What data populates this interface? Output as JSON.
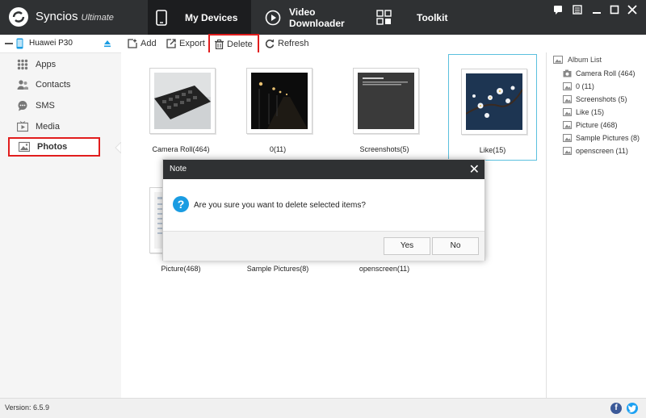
{
  "app": {
    "name": "Syncios",
    "edition": "Ultimate"
  },
  "tabs": [
    {
      "label": "My Devices"
    },
    {
      "label": "Video Downloader"
    },
    {
      "label": "Toolkit"
    }
  ],
  "device": {
    "name": "Huawei P30"
  },
  "sidebar": {
    "items": [
      {
        "label": "Apps"
      },
      {
        "label": "Contacts"
      },
      {
        "label": "SMS"
      },
      {
        "label": "Media"
      },
      {
        "label": "Photos"
      }
    ]
  },
  "toolbar": {
    "add": "Add",
    "export": "Export",
    "delete": "Delete",
    "refresh": "Refresh"
  },
  "albums": [
    {
      "caption": "Camera Roll(464)"
    },
    {
      "caption": "0(11)"
    },
    {
      "caption": "Screenshots(5)"
    },
    {
      "caption": "Like(15)"
    },
    {
      "caption": "Picture(468)"
    },
    {
      "caption": "Sample Pictures(8)"
    },
    {
      "caption": "openscreen(11)"
    }
  ],
  "album_list": {
    "title": "Album List",
    "items": [
      {
        "label": "Camera Roll (464)"
      },
      {
        "label": "0 (11)"
      },
      {
        "label": "Screenshots (5)"
      },
      {
        "label": "Like (15)"
      },
      {
        "label": "Picture (468)"
      },
      {
        "label": "Sample Pictures (8)"
      },
      {
        "label": "openscreen (11)"
      }
    ]
  },
  "status": {
    "version": "Version: 6.5.9"
  },
  "dialog": {
    "title": "Note",
    "message": "Are you sure you want to delete selected items?",
    "yes": "Yes",
    "no": "No"
  },
  "colors": {
    "highlight": "#e11d1d",
    "accent": "#1a9ce2",
    "topbar": "#2f3133"
  }
}
